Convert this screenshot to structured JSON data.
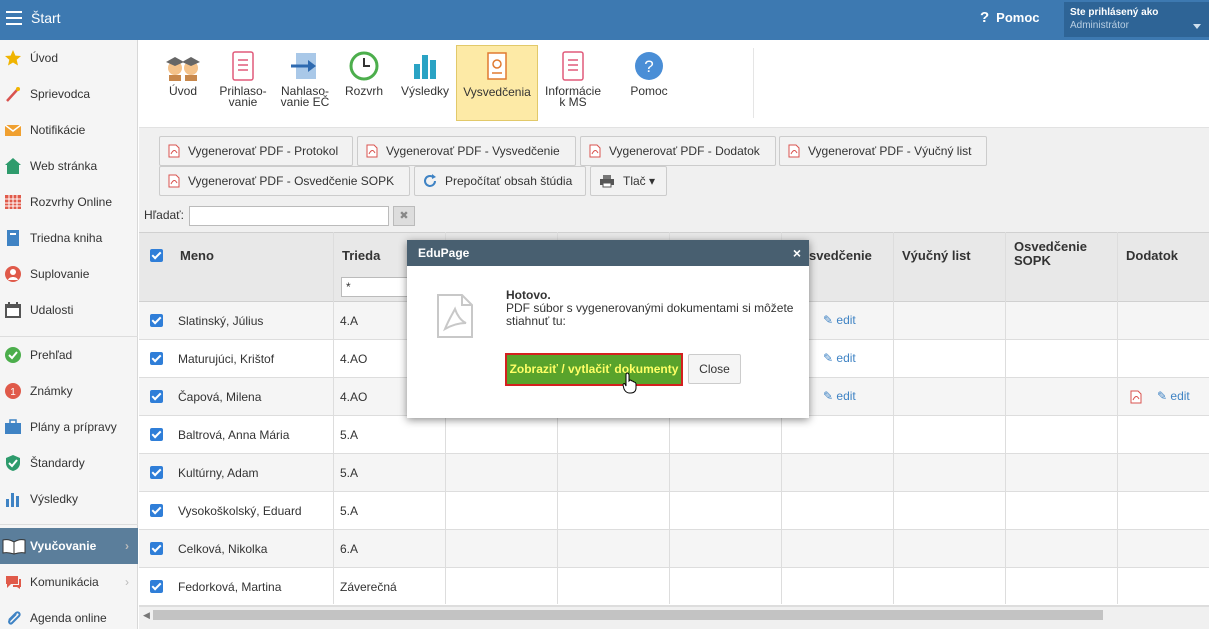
{
  "topbar": {
    "title": "Štart",
    "help_label": "Pomoc",
    "user_line1": "Ste prihlásený ako",
    "user_line2": "Administrátor"
  },
  "sidebar": {
    "items": [
      {
        "label": "Úvod",
        "icon": "star-icon"
      },
      {
        "label": "Sprievodca",
        "icon": "wand-icon"
      },
      {
        "label": "Notifikácie",
        "icon": "envelope-icon"
      },
      {
        "label": "Web stránka",
        "icon": "home-icon"
      },
      {
        "label": "Rozvrhy Online",
        "icon": "grid-icon"
      },
      {
        "label": "Triedna kniha",
        "icon": "book-icon"
      },
      {
        "label": "Suplovanie",
        "icon": "person-icon"
      },
      {
        "label": "Udalosti",
        "icon": "calendar-icon"
      },
      {
        "label": "Prehľad",
        "icon": "check-circle-icon"
      },
      {
        "label": "Známky",
        "icon": "grade-icon"
      },
      {
        "label": "Plány a prípravy",
        "icon": "briefcase-icon"
      },
      {
        "label": "Štandardy",
        "icon": "shield-icon"
      },
      {
        "label": "Výsledky",
        "icon": "bar-chart-icon"
      },
      {
        "label": "Vyučovanie",
        "icon": "open-book-icon"
      },
      {
        "label": "Komunikácia",
        "icon": "chat-icon"
      },
      {
        "label": "Agenda online",
        "icon": "paperclip-icon"
      }
    ]
  },
  "toolbar": {
    "uvod": "Úvod",
    "prihlasovanie_1": "Prihlaso-",
    "prihlasovanie_2": "vanie",
    "nahlasovanie_1": "Nahlaso-",
    "nahlasovanie_2": "vanie EČ",
    "rozvrh": "Rozvrh",
    "vysledky": "Výsledky",
    "vysvedcenia": "Vysvedčenia",
    "informacie_1": "Informácie",
    "informacie_2": "k MS",
    "pomoc": "Pomoc"
  },
  "actions": {
    "protokol": "Vygenerovať PDF - Protokol",
    "vysvedcenie": "Vygenerovať PDF - Vysvedčenie",
    "dodatok": "Vygenerovať PDF - Dodatok",
    "vyucny": "Vygenerovať PDF - Výučný list",
    "sopk": "Vygenerovať PDF - Osvedčenie SOPK",
    "prepocitat": "Prepočítať obsah štúdia",
    "tlac": "Tlač ▾"
  },
  "search": {
    "label": "Hľadať:",
    "clear": "✖"
  },
  "table": {
    "headers": {
      "meno": "Meno",
      "trieda": "Trieda",
      "vysvedcenie": "svedčenie",
      "vyucny": "Výučný list",
      "sopk": "Osvedčenie SOPK",
      "dodatok": "Dodatok"
    },
    "class_filter": "*",
    "edit_label": "edit",
    "rows": [
      {
        "name": "Slatinský, Július",
        "class": "4.A"
      },
      {
        "name": "Maturujúci, Krištof",
        "class": "4.AO"
      },
      {
        "name": "Čapová, Milena",
        "class": "4.AO"
      },
      {
        "name": "Baltrová, Anna Mária",
        "class": "5.A"
      },
      {
        "name": "Kultúrny, Adam",
        "class": "5.A"
      },
      {
        "name": "Vysokoškolský, Eduard",
        "class": "5.A"
      },
      {
        "name": "Celková, Nikolka",
        "class": "6.A"
      },
      {
        "name": "Fedorková, Martina",
        "class": "Záverečná"
      }
    ]
  },
  "dialog": {
    "title": "EduPage",
    "close_glyph": "×",
    "heading": "Hotovo.",
    "message": "PDF súbor s vygenerovanými dokumentami si môžete stiahnuť tu:",
    "primary": "Zobraziť / vytlačiť dokumenty",
    "secondary": "Close"
  },
  "colors": {
    "topbar": "#3d79b1",
    "accent": "#2f7ed8",
    "primary_btn": "#59a32c",
    "selected_tab": "#fdeaa6"
  }
}
